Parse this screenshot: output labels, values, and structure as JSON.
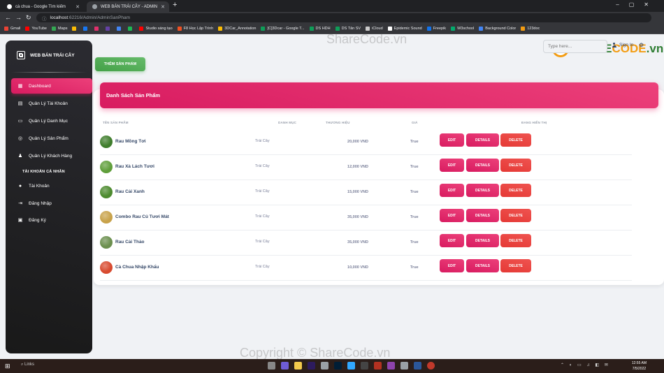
{
  "browser": {
    "tabs": [
      {
        "title": "cà chua - Google Tìm kiếm",
        "fav_color": "#ffffff"
      },
      {
        "title": "WEB BÁN TRÁI CÂY - ADMIN",
        "fav_color": "#9aa0a6"
      }
    ],
    "url_host": "localhost",
    "url_path": ":62216/Admin/AdminSanPham",
    "bookmarks": [
      {
        "label": "Gmail",
        "color": "#ea4335"
      },
      {
        "label": "YouTube",
        "color": "#ff0000"
      },
      {
        "label": "Maps",
        "color": "#34a853"
      },
      {
        "label": "",
        "color": "#fbbc04"
      },
      {
        "label": "",
        "color": "#1877f2"
      },
      {
        "label": "",
        "color": "#e1306c"
      },
      {
        "label": "",
        "color": "#6441a5"
      },
      {
        "label": "",
        "color": "#4285f4"
      },
      {
        "label": "",
        "color": "#1db954"
      },
      {
        "label": "Studio sáng tạo",
        "color": "#ff0000"
      },
      {
        "label": "F8 Học Lập Trình",
        "color": "#f05123"
      },
      {
        "label": "3DCar_Annotation",
        "color": "#fbbc04"
      },
      {
        "label": "[C]3Dcar - Google T...",
        "color": "#0f9d58"
      },
      {
        "label": "DS HDH",
        "color": "#0f9d58"
      },
      {
        "label": "DS Tân SV",
        "color": "#0f9d58"
      },
      {
        "label": "iCloud",
        "color": "#cccccc"
      },
      {
        "label": "Epidemic Sound",
        "color": "#ffffff"
      },
      {
        "label": "Freepik",
        "color": "#1273eb"
      },
      {
        "label": "W3school",
        "color": "#04aa6d"
      },
      {
        "label": "Background Color",
        "color": "#4285f4"
      },
      {
        "label": "123doc",
        "color": "#f39c12"
      }
    ]
  },
  "sidebar": {
    "brand": "WEB BÁN TRÁI CÂY",
    "items": [
      {
        "label": "Dashboard",
        "icon": "dashboard-icon"
      },
      {
        "label": "Quản Lý Tài Khoản",
        "icon": "account-icon"
      },
      {
        "label": "Quản Lý Danh Mục",
        "icon": "category-icon"
      },
      {
        "label": "Quản Lý Sản Phẩm",
        "icon": "product-icon"
      },
      {
        "label": "Quản Lý Khách Hàng",
        "icon": "customer-icon"
      }
    ],
    "section_title": "TÀI KHOẢN CÁ NHÂN",
    "personal": [
      {
        "label": "Tài Khoản",
        "icon": "person-icon"
      },
      {
        "label": "Đăng Nhập",
        "icon": "login-icon"
      },
      {
        "label": "Đăng Ký",
        "icon": "register-icon"
      }
    ]
  },
  "topbar": {
    "search_placeholder": "Type here...",
    "signin": "Sign In"
  },
  "main": {
    "add_button": "THÊM SẢN PHẨM",
    "card_title": "Danh Sách Sản Phẩm",
    "columns": [
      "TÊN SẢN PHẨM",
      "DANH MỤC",
      "THƯƠNG HIỆU",
      "GIÁ",
      "ĐANG HIỂN THỊ"
    ],
    "actions": {
      "edit": "EDIT",
      "details": "DETAILS",
      "delete": "DELETE"
    },
    "products": [
      {
        "name": "Rau Mồng Tơi",
        "category": "Trái Cây",
        "price": "20,000 VND",
        "visible": "True",
        "thumb": "#3f7d2c"
      },
      {
        "name": "Rau Xà Lách Tươi",
        "category": "Trái Cây",
        "price": "12,000 VND",
        "visible": "True",
        "thumb": "#5f9e3a"
      },
      {
        "name": "Rau Cải Xanh",
        "category": "Trái Cây",
        "price": "15,000 VND",
        "visible": "True",
        "thumb": "#4c8a2e"
      },
      {
        "name": "Combo Rau Củ Tươi Mát",
        "category": "Trái Cây",
        "price": "35,000 VND",
        "visible": "True",
        "thumb": "#c8a24a"
      },
      {
        "name": "Rau Cải Thảo",
        "category": "Trái Cây",
        "price": "35,000 VND",
        "visible": "True",
        "thumb": "#6b8f4e"
      },
      {
        "name": "Cà Chua Nhập Khẩu",
        "category": "Trái Cây",
        "price": "10,000 VND",
        "visible": "True",
        "thumb": "#d84a2f"
      }
    ]
  },
  "watermark": {
    "top": "ShareCode.vn",
    "bottom": "Copyright © ShareCode.vn",
    "logo_share": "SHARE",
    "logo_code": "CODE",
    "logo_vn": ".vn"
  },
  "taskbar": {
    "search": "Links",
    "time": "12:55 AM",
    "date": "7/5/2022"
  }
}
